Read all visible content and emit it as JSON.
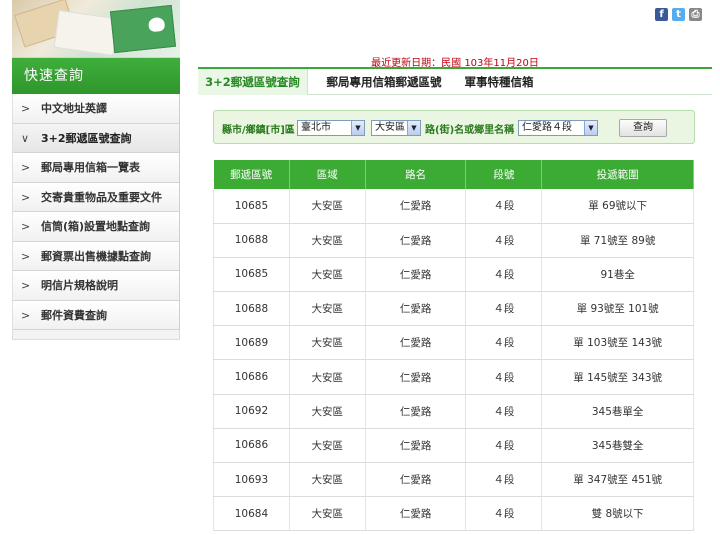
{
  "sidebar": {
    "title": "快速查詢",
    "items": [
      {
        "label": "中文地址英譯",
        "active": false
      },
      {
        "label": "3+2郵遞區號查詢",
        "active": true
      },
      {
        "label": "郵局專用信箱一覽表",
        "active": false
      },
      {
        "label": "交寄貴重物品及重要文件",
        "active": false
      },
      {
        "label": "信筒(箱)設置地點查詢",
        "active": false
      },
      {
        "label": "郵資票出售機據點查詢",
        "active": false
      },
      {
        "label": "明信片規格說明",
        "active": false
      },
      {
        "label": "郵件資費查詢",
        "active": false
      }
    ]
  },
  "social": {
    "facebook": "f",
    "twitter": "t",
    "print": "⎙"
  },
  "update_text": "最近更新日期：民國 103年11月20日",
  "tabs": [
    "3+2郵遞區號查詢",
    "郵局專用信箱郵遞區號",
    "軍事特種信箱"
  ],
  "search": {
    "city_label": "縣市/鄉鎮[市]區",
    "city_value": "臺北市",
    "district_value": "大安區",
    "road_label": "路(街)名或鄉里名稱",
    "road_value": "仁愛路４段",
    "query_button": "查詢"
  },
  "table": {
    "headers": [
      "郵遞區號",
      "區域",
      "路名",
      "段號",
      "投遞範圍"
    ],
    "rows": [
      [
        "10685",
        "大安區",
        "仁愛路",
        "４段",
        "單 69號以下"
      ],
      [
        "10688",
        "大安區",
        "仁愛路",
        "４段",
        "單 71號至 89號"
      ],
      [
        "10685",
        "大安區",
        "仁愛路",
        "４段",
        "91巷全"
      ],
      [
        "10688",
        "大安區",
        "仁愛路",
        "４段",
        "單 93號至 101號"
      ],
      [
        "10689",
        "大安區",
        "仁愛路",
        "４段",
        "單 103號至 143號"
      ],
      [
        "10686",
        "大安區",
        "仁愛路",
        "４段",
        "單 145號至 343號"
      ],
      [
        "10692",
        "大安區",
        "仁愛路",
        "４段",
        "345巷單全"
      ],
      [
        "10686",
        "大安區",
        "仁愛路",
        "４段",
        "345巷雙全"
      ],
      [
        "10693",
        "大安區",
        "仁愛路",
        "４段",
        "單 347號至 451號"
      ],
      [
        "10684",
        "大安區",
        "仁愛路",
        "４段",
        "雙 8號以下"
      ]
    ]
  },
  "colors": {
    "accent": "#3bab33",
    "update": "#c0000f"
  }
}
